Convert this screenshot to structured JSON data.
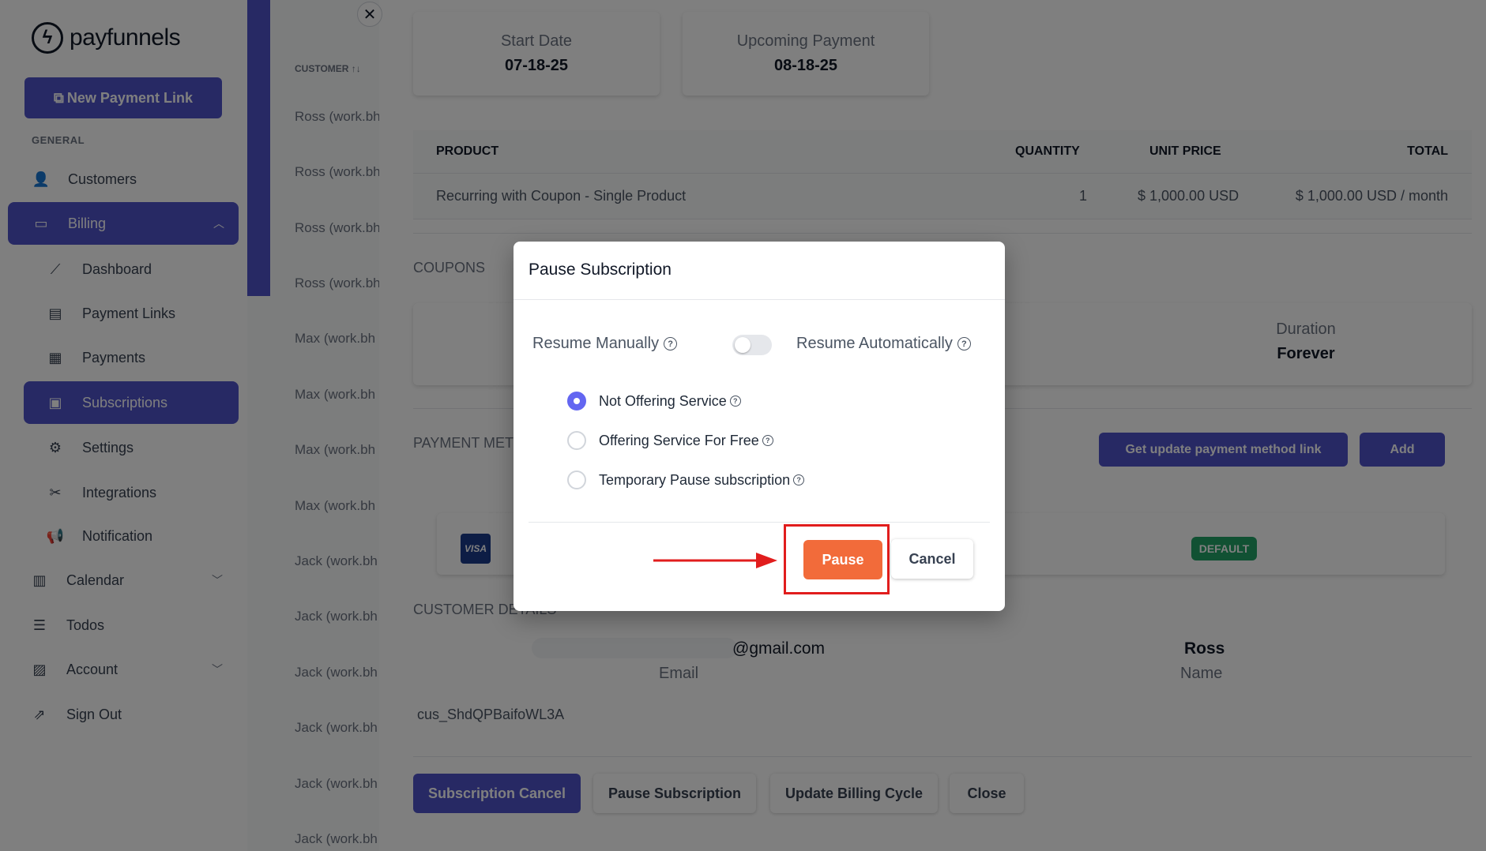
{
  "sidebar": {
    "logo_text": "payfunnels",
    "new_link_label": "New Payment Link",
    "section_general": "GENERAL",
    "items": {
      "customers": "Customers",
      "billing": "Billing",
      "dashboard": "Dashboard",
      "payment_links": "Payment Links",
      "payments": "Payments",
      "subscriptions": "Subscriptions",
      "settings": "Settings",
      "integrations": "Integrations",
      "notification": "Notification",
      "calendar": "Calendar",
      "todos": "Todos",
      "account": "Account",
      "sign_out": "Sign Out"
    }
  },
  "list": {
    "header": "CUSTOMER ↑↓",
    "rows": [
      "Ross (work.bh",
      "Ross (work.bh",
      "Ross (work.bh",
      "Ross (work.bh",
      "Max (work.bh",
      "Max (work.bh",
      "Max (work.bh",
      "Max (work.bh",
      "Jack (work.bh",
      "Jack (work.bh",
      "Jack (work.bh",
      "Jack (work.bh",
      "Jack (work.bh",
      "Jack (work.bh"
    ]
  },
  "detail": {
    "start_date_label": "Start Date",
    "start_date_value": "07-18-25",
    "upcoming_label": "Upcoming Payment",
    "upcoming_value": "08-18-25",
    "table": {
      "headers": {
        "product": "PRODUCT",
        "quantity": "QUANTITY",
        "unit_price": "UNIT PRICE",
        "total": "TOTAL"
      },
      "row": {
        "product": "Recurring with Coupon - Single Product",
        "quantity": "1",
        "unit_price": "$ 1,000.00 USD",
        "total": "$ 1,000.00 USD / month"
      }
    },
    "coupons_title": "COUPONS",
    "duration_label": "Duration",
    "duration_value": "Forever",
    "payment_method_title": "PAYMENT METH",
    "get_update_link_label": "Get update payment method link",
    "add_label": "Add",
    "visa_label": "VISA",
    "default_badge": "DEFAULT",
    "customer_details_title": "CUSTOMER DETAILS",
    "email_value": "@gmail.com",
    "email_label": "Email",
    "name_value": "Ross",
    "name_label": "Name",
    "customer_id": "cus_ShdQPBaifoWL3A",
    "buttons": {
      "subscription_cancel": "Subscription Cancel",
      "pause_subscription": "Pause Subscription",
      "update_billing_cycle": "Update Billing Cycle",
      "close": "Close"
    }
  },
  "modal": {
    "title": "Pause Subscription",
    "resume_manually": "Resume Manually",
    "resume_automatically": "Resume Automatically",
    "options": [
      "Not Offering Service",
      "Offering Service For Free",
      "Temporary Pause subscription"
    ],
    "selected_index": 0,
    "pause_label": "Pause",
    "cancel_label": "Cancel"
  },
  "colors": {
    "primary": "#4f52c9",
    "pause": "#f26b3a",
    "highlight": "#e11d1d",
    "default_badge": "#22a366"
  }
}
